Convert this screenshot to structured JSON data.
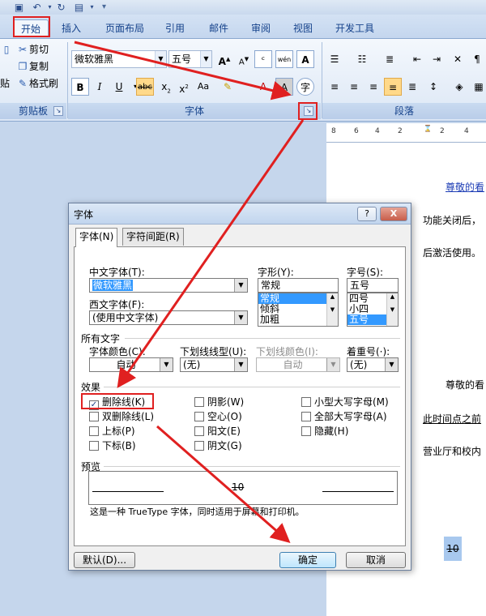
{
  "ribbon": {
    "tabs": [
      {
        "label": "开始"
      },
      {
        "label": "插入"
      },
      {
        "label": "页面布局"
      },
      {
        "label": "引用"
      },
      {
        "label": "邮件"
      },
      {
        "label": "审阅"
      },
      {
        "label": "视图"
      },
      {
        "label": "开发工具"
      }
    ],
    "clipboard": {
      "cut": "剪切",
      "copy": "复制",
      "format_painter": "格式刷",
      "paste_fragment": "贴",
      "group_label": "剪贴板"
    },
    "font": {
      "font_name": "微软雅黑",
      "font_size": "五号",
      "group_label": "字体"
    },
    "paragraph": {
      "group_label": "段落"
    }
  },
  "ruler": {
    "marks": [
      "8",
      "6",
      "4",
      "2",
      "2",
      "4"
    ]
  },
  "document": {
    "line1": "尊敬的看",
    "line2": "功能关闭后，",
    "line3": "后激活使用。",
    "line4": "尊敬的看",
    "line5": "此时间点之前",
    "line6": "营业厅和校内",
    "sample": "10"
  },
  "dialog": {
    "title": "字体",
    "help": "?",
    "close": "X",
    "tabs": {
      "font": "字体(N)",
      "spacing": "字符间距(R)"
    },
    "cn_font_label": "中文字体(T):",
    "cn_font_value": "微软雅黑",
    "west_font_label": "西文字体(F):",
    "west_font_value": "(使用中文字体)",
    "style_label": "字形(Y):",
    "style_value": "常规",
    "style_list": [
      "常规",
      "倾斜",
      "加粗"
    ],
    "size_label": "字号(S):",
    "size_value": "五号",
    "size_list": [
      "四号",
      "小四",
      "五号"
    ],
    "all_text": "所有文字",
    "font_color_label": "字体颜色(C):",
    "font_color_value": "自动",
    "underline_type_label": "下划线线型(U):",
    "underline_type_value": "(无)",
    "underline_color_label": "下划线颜色(I):",
    "underline_color_value": "自动",
    "emphasis_label": "着重号(·):",
    "emphasis_value": "(无)",
    "effects": "效果",
    "effect_items": {
      "strikethrough": "删除线(K)",
      "double_strikethrough": "双删除线(L)",
      "superscript": "上标(P)",
      "subscript": "下标(B)",
      "shadow": "阴影(W)",
      "outline": "空心(O)",
      "emboss": "阳文(E)",
      "engrave": "阴文(G)",
      "small_caps": "小型大写字母(M)",
      "all_caps": "全部大写字母(A)",
      "hidden": "隐藏(H)"
    },
    "preview_label": "预览",
    "preview_text": "10",
    "description": "这是一种 TrueType 字体，同时适用于屏幕和打印机。",
    "default_button": "默认(D)...",
    "ok_button": "确定",
    "cancel_button": "取消"
  },
  "colors": {
    "annotation_red": "#e02020",
    "selection_blue": "#3399ff",
    "ribbon_text": "#15428b"
  }
}
